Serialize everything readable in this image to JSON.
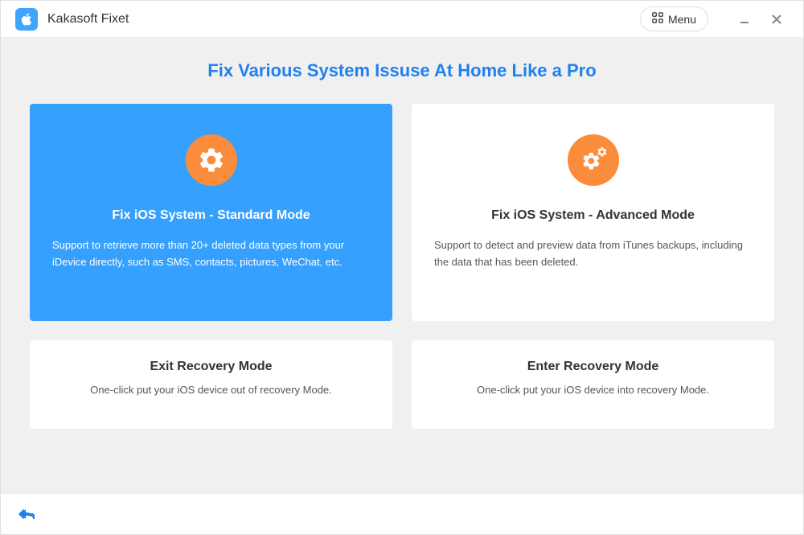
{
  "app": {
    "title": "Kakasoft Fixet",
    "menu_label": "Menu"
  },
  "page": {
    "title": "Fix Various System Issuse At Home Like a Pro"
  },
  "cards": {
    "standard": {
      "title": "Fix iOS System - Standard Mode",
      "desc": "Support to retrieve more than 20+ deleted data types from your iDevice directly, such as SMS, contacts, pictures, WeChat, etc."
    },
    "advanced": {
      "title": "Fix iOS System - Advanced Mode",
      "desc": "Support to detect and preview data from iTunes backups, including the data that has been deleted."
    },
    "exit_recovery": {
      "title": "Exit Recovery Mode",
      "desc": "One-click put your iOS device out of recovery Mode."
    },
    "enter_recovery": {
      "title": "Enter Recovery Mode",
      "desc": "One-click put your iOS device into recovery Mode."
    }
  },
  "colors": {
    "primary": "#35a0fd",
    "accent": "#fa8c3c",
    "heading": "#2080f0"
  }
}
